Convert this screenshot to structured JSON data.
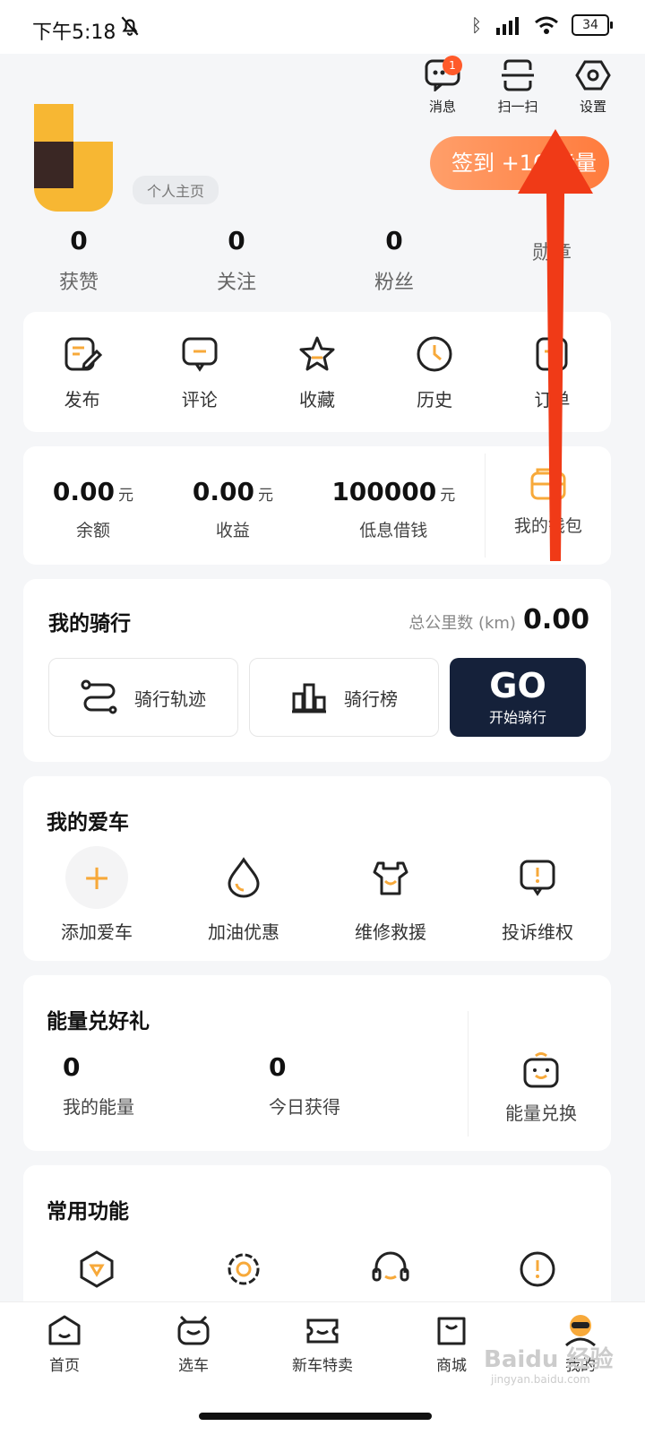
{
  "status": {
    "time": "下午5:18",
    "battery": "34"
  },
  "top_actions": [
    {
      "label": "消息",
      "badge": "1"
    },
    {
      "label": "扫一扫"
    },
    {
      "label": "设置"
    }
  ],
  "profile": {
    "tag": "个人主页",
    "signin": "签到 +10 能量"
  },
  "stats": [
    {
      "n": "0",
      "l": "获赞"
    },
    {
      "n": "0",
      "l": "关注"
    },
    {
      "n": "0",
      "l": "粉丝"
    },
    {
      "n": "",
      "l": "勋章"
    }
  ],
  "quick": [
    "发布",
    "评论",
    "收藏",
    "历史",
    "订单"
  ],
  "wallet": {
    "items": [
      {
        "n": "0.00",
        "u": "元",
        "l": "余额"
      },
      {
        "n": "0.00",
        "u": "元",
        "l": "收益"
      },
      {
        "n": "100000",
        "u": "元",
        "l": "低息借钱"
      }
    ],
    "mine": "我的钱包"
  },
  "riding": {
    "title": "我的骑行",
    "total_label": "总公里数 (km)",
    "total": "0.00",
    "track": "骑行轨迹",
    "rank": "骑行榜",
    "go": "GO",
    "go_sub": "开始骑行"
  },
  "car": {
    "title": "我的爱车",
    "items": [
      "添加爱车",
      "加油优惠",
      "维修救援",
      "投诉维权"
    ]
  },
  "energy": {
    "title": "能量兑好礼",
    "mine_n": "0",
    "mine_l": "我的能量",
    "today_n": "0",
    "today_l": "今日获得",
    "exchange": "能量兑换"
  },
  "common": {
    "title": "常用功能"
  },
  "tabbar": [
    "首页",
    "选车",
    "新车特卖",
    "商城",
    "我的"
  ],
  "watermark": {
    "brand": "Baidu 经验",
    "url": "jingyan.baidu.com"
  },
  "colors": {
    "accent": "#f7a93a",
    "orange": "#ff7b3d",
    "arrow": "#f03a17",
    "dark": "#15213a"
  }
}
